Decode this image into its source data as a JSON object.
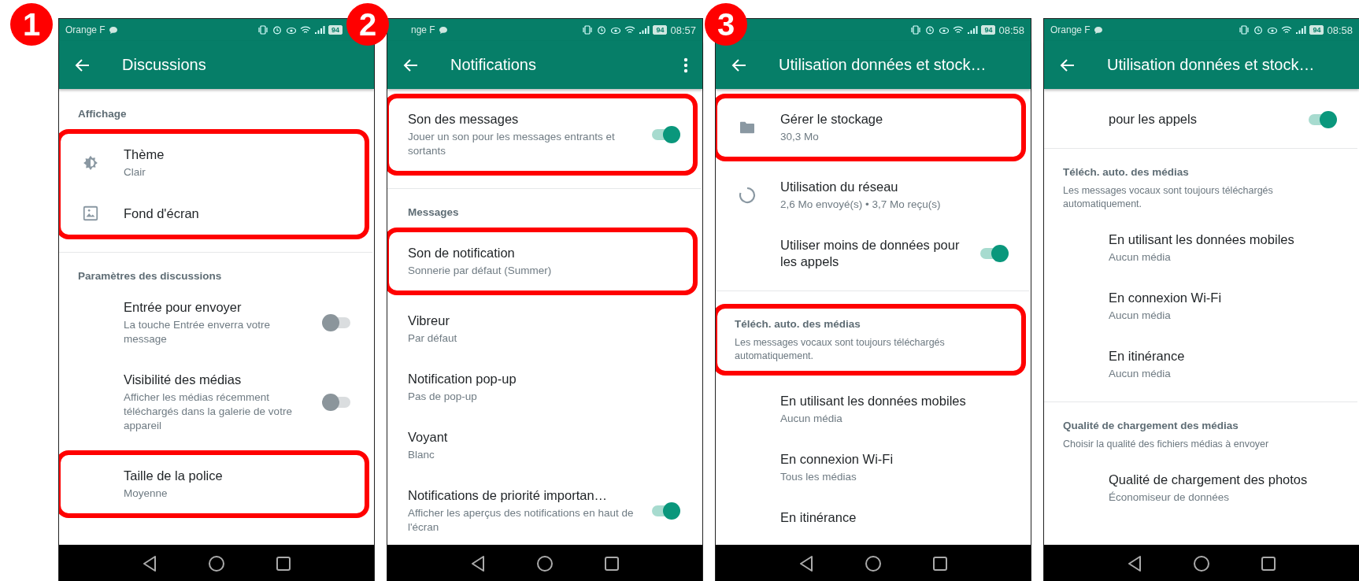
{
  "panels": [
    {
      "badge": "1",
      "status": {
        "carrier": "Orange F",
        "battery": "94"
      },
      "title": "Discussions",
      "icons": true,
      "blocks": [
        {
          "highlighted": false,
          "items": [
            {
              "kind": "header",
              "text": "Affichage"
            }
          ]
        },
        {
          "highlighted": true,
          "items": [
            {
              "kind": "theme",
              "title": "Thème",
              "subtitle": "Clair"
            },
            {
              "kind": "wallpaper",
              "title": "Fond d'écran"
            }
          ]
        },
        {
          "highlighted": false,
          "items": [
            {
              "kind": "divider"
            },
            {
              "kind": "header",
              "text": "Paramètres des discussions"
            },
            {
              "kind": "setting",
              "title": "Entrée pour envoyer",
              "subtitle": "La touche Entrée enverra votre message",
              "on": false
            },
            {
              "kind": "setting",
              "title": "Visibilité des médias",
              "subtitle": "Afficher les médias récemment téléchargés dans la galerie de votre appareil",
              "on": false
            }
          ]
        },
        {
          "highlighted": true,
          "items": [
            {
              "kind": "setting",
              "title": "Taille de la police",
              "subtitle": "Moyenne"
            }
          ]
        }
      ]
    },
    {
      "badge": "2",
      "status": {
        "carrier": "nge F",
        "battery": "94",
        "time": "08:57"
      },
      "title": "Notifications",
      "menu": true,
      "icons": false,
      "blocks": [
        {
          "highlighted": true,
          "items": [
            {
              "kind": "setting",
              "title": "Son des messages",
              "subtitle": "Jouer un son pour les messages entrants et sortants",
              "on": true
            }
          ]
        },
        {
          "highlighted": false,
          "items": [
            {
              "kind": "divider"
            },
            {
              "kind": "header",
              "text": "Messages"
            }
          ]
        },
        {
          "highlighted": true,
          "items": [
            {
              "kind": "setting",
              "title": "Son de notification",
              "subtitle": "Sonnerie par défaut (Summer)"
            }
          ]
        },
        {
          "highlighted": false,
          "items": [
            {
              "kind": "setting",
              "title": "Vibreur",
              "subtitle": "Par défaut"
            },
            {
              "kind": "setting",
              "title": "Notification pop-up",
              "subtitle": "Pas de pop-up"
            },
            {
              "kind": "setting",
              "title": "Voyant",
              "subtitle": "Blanc"
            },
            {
              "kind": "setting",
              "title": "Notifications de priorité importan…",
              "subtitle": "Afficher les aperçus des notifications en haut de l'écran",
              "on": true
            }
          ]
        }
      ]
    },
    {
      "badge": "3",
      "status": {
        "battery": "94",
        "time": "08:58"
      },
      "title": "Utilisation données et stock…",
      "icons": true,
      "blocks": [
        {
          "highlighted": true,
          "items": [
            {
              "kind": "storage",
              "title": "Gérer le stockage",
              "subtitle": "30,3 Mo"
            }
          ]
        },
        {
          "highlighted": false,
          "items": [
            {
              "kind": "network",
              "title": "Utilisation du réseau",
              "subtitle": "2,6 Mo envoyé(s) • 3,7 Mo reçu(s)"
            },
            {
              "kind": "setting",
              "title": "Utiliser moins de données pour les appels",
              "on": true
            },
            {
              "kind": "divider"
            }
          ]
        },
        {
          "highlighted": true,
          "items": [
            {
              "kind": "header",
              "text": "Téléch. auto. des médias"
            },
            {
              "kind": "note",
              "text": "Les messages vocaux sont toujours téléchargés automatiquement."
            }
          ]
        },
        {
          "highlighted": false,
          "items": [
            {
              "kind": "setting",
              "title": "En utilisant les données mobiles",
              "subtitle": "Aucun média"
            },
            {
              "kind": "setting",
              "title": "En connexion Wi-Fi",
              "subtitle": "Tous les médias"
            },
            {
              "kind": "setting",
              "title": "En itinérance"
            }
          ]
        }
      ]
    },
    {
      "status": {
        "carrier": "Orange F",
        "battery": "94",
        "time": "08:58"
      },
      "title": "Utilisation données et stock…",
      "icons": true,
      "blocks": [
        {
          "highlighted": false,
          "items": [
            {
              "kind": "setting",
              "title": "pour les appels",
              "on": true
            },
            {
              "kind": "divider"
            },
            {
              "kind": "header",
              "text": "Téléch. auto. des médias"
            },
            {
              "kind": "note",
              "text": "Les messages vocaux sont toujours téléchargés automatiquement."
            },
            {
              "kind": "setting",
              "title": "En utilisant les données mobiles",
              "subtitle": "Aucun média"
            },
            {
              "kind": "setting",
              "title": "En connexion Wi-Fi",
              "subtitle": "Aucun média"
            },
            {
              "kind": "setting",
              "title": "En itinérance",
              "subtitle": "Aucun média"
            },
            {
              "kind": "divider"
            },
            {
              "kind": "header",
              "text": "Qualité de chargement des médias"
            },
            {
              "kind": "note",
              "text": "Choisir la qualité des fichiers médias à envoyer"
            },
            {
              "kind": "setting",
              "title": "Qualité de chargement des photos",
              "subtitle": "Économiseur de données"
            }
          ]
        }
      ]
    }
  ]
}
